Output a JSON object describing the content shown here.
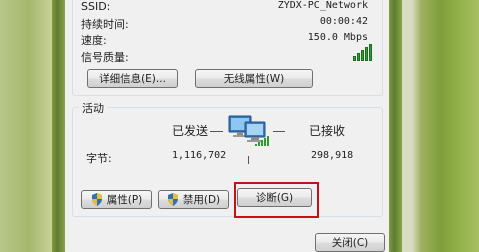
{
  "connection": {
    "ssid_label": "SSID:",
    "ssid_value": "ZYDX-PC_Network",
    "duration_label": "持续时间:",
    "duration_value": "00:00:42",
    "speed_label": "速度:",
    "speed_value": "150.0 Mbps",
    "signal_label": "信号质量:",
    "signal_bars": 5
  },
  "buttons": {
    "details": "详细信息(E)...",
    "wireless_props": "无线属性(W)",
    "properties": "属性(P)",
    "disable": "禁用(D)",
    "diagnose": "诊断(G)",
    "close": "关闭(C)"
  },
  "activity": {
    "title": "活动",
    "sent_label": "已发送",
    "received_label": "已接收",
    "bytes_label": "字节:",
    "sent_bytes": "1,116,702",
    "received_bytes": "298,918"
  },
  "colors": {
    "highlight_box": "#c8101a",
    "signal_green": "#2f9c2f",
    "desktop_green": "#8fad45"
  },
  "icons": {
    "network": "network-computers-icon",
    "shield": "uac-shield-icon",
    "signal": "signal-strength-icon"
  }
}
